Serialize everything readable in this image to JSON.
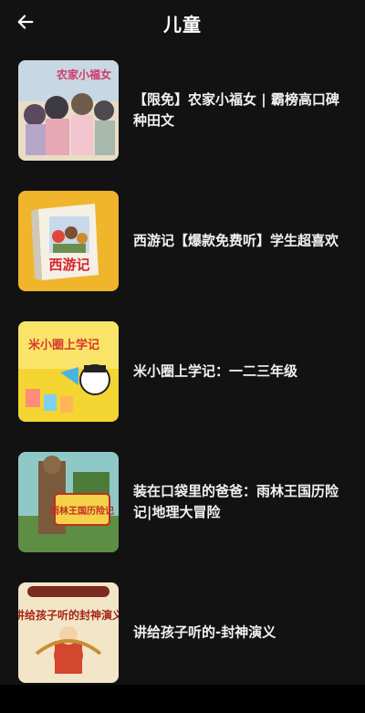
{
  "header": {
    "title": "儿童",
    "back_icon": "arrow-left-icon"
  },
  "items": [
    {
      "title": "【限免】农家小福女 | 霸榜高口碑种田文",
      "cover_text": "农家小福女"
    },
    {
      "title": "西游记【爆款免费听】学生超喜欢",
      "cover_text": "西游记"
    },
    {
      "title": "米小圈上学记：一二三年级",
      "cover_text": "米小圈上学记"
    },
    {
      "title": "装在口袋里的爸爸：雨林王国历险记|地理大冒险",
      "cover_text": "雨林王国历险记"
    },
    {
      "title": "讲给孩子听的-封神演义",
      "cover_text": "讲给孩子听的封神演义"
    }
  ],
  "colors": {
    "background": "#121212",
    "text": "#ffffff"
  }
}
